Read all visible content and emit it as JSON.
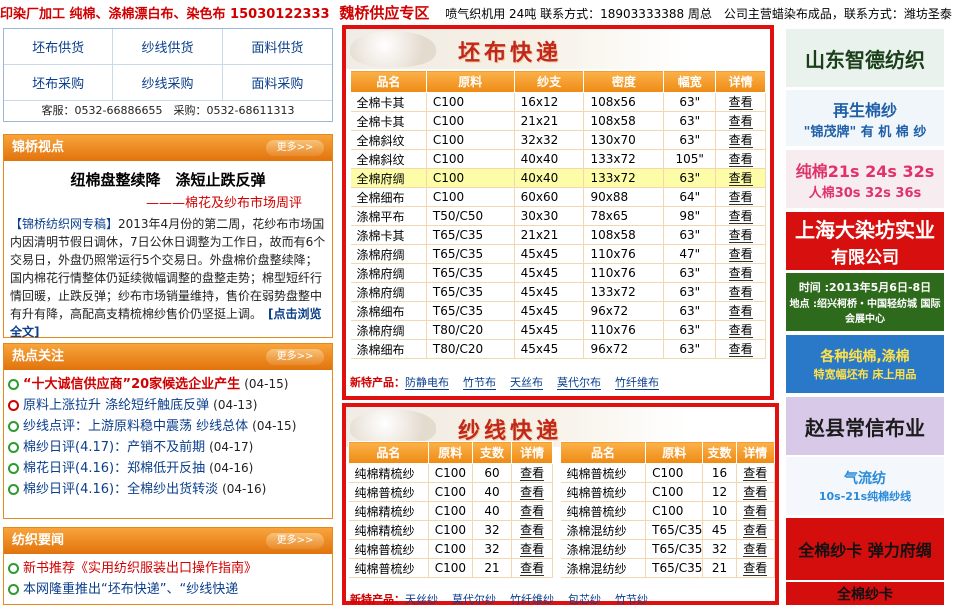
{
  "ticker": {
    "hot": "印染厂加工 纯棉、涤棉漂白布、染色布 15030122333",
    "zone": "魏桥供应专区",
    "rest": "喷气织机用 24吨 联系方式：18903333388 周总　公司主营蜡染布成品，联系方式：潍坊圣泰"
  },
  "nav": {
    "items": [
      "坯布供货",
      "纱线供货",
      "面料供货",
      "坯布采购",
      "纱线采购",
      "面料采购"
    ],
    "service": "客服：0532-66886655　采购：0532-68611313"
  },
  "panel1": {
    "title": "锦桥视点",
    "more": "更多>>",
    "headline": "纽棉盘整续降　涤短止跌反弹",
    "subline": "———棉花及纱布市场周评",
    "brand": "【锦桥纺织网专稿】",
    "body": "2013年4月份的第二周，花纱布市场国内因清明节假日调休，7日公休日调整为工作日，故而有6个交易日，外盘仍照常运行5个交易日。外盘棉价盘整续降；国内棉花行情整体仍延续微幅调整的盘整走势；棉型短纤行情回暖，止跌反弹；纱布市场销量维持，售价在弱势盘整中有升有降，高配高支精梳棉纱售价仍坚挺上调。",
    "read": "[点击浏览全文]"
  },
  "panel2": {
    "title": "热点关注",
    "more": "更多>>",
    "items": [
      {
        "t": "“十大诚信供应商”20家候选企业产生",
        "d": "(04-15)",
        "style": "hl"
      },
      {
        "t": "原料上涨拉升 涤纶短纤触底反弹",
        "d": "(04-13)",
        "style": "normal",
        "dot": "red"
      },
      {
        "t": "纱线点评：上游原料稳中震荡 纱线总体",
        "d": "(04-15)",
        "style": "normal"
      },
      {
        "t": "棉纱日评(4.17)：产销不及前期",
        "d": "(04-17)",
        "style": "normal"
      },
      {
        "t": "棉花日评(4.16)：郑棉低开反抽",
        "d": "(04-16)",
        "style": "normal"
      },
      {
        "t": "棉纱日评(4.16)：全棉纱出货转淡",
        "d": "(04-16)",
        "style": "normal"
      }
    ]
  },
  "panel3": {
    "title": "纺织要闻",
    "more": "更多>>",
    "items": [
      {
        "t": "新书推荐《实用纺织服装出口操作指南》",
        "style": "red"
      },
      {
        "t": "本网隆重推出“坯布快递”、“纱线快递",
        "style": "normal"
      }
    ]
  },
  "fabric": {
    "title": "坯布快递",
    "headers": [
      "品名",
      "原料",
      "纱支",
      "密度",
      "幅宽",
      "详情"
    ],
    "rows": [
      [
        "全棉卡其",
        "C100",
        "16x12",
        "108x56",
        "63\"",
        "查看"
      ],
      [
        "全棉卡其",
        "C100",
        "21x21",
        "108x58",
        "63\"",
        "查看"
      ],
      [
        "全棉斜纹",
        "C100",
        "32x32",
        "130x70",
        "63\"",
        "查看"
      ],
      [
        "全棉斜纹",
        "C100",
        "40x40",
        "133x72",
        "105\"",
        "查看"
      ],
      [
        "全棉府绸",
        "C100",
        "40x40",
        "133x72",
        "63\"",
        "查看"
      ],
      [
        "全棉细布",
        "C100",
        "60x60",
        "90x88",
        "64\"",
        "查看"
      ],
      [
        "涤棉平布",
        "T50/C50",
        "30x30",
        "78x65",
        "98\"",
        "查看"
      ],
      [
        "涤棉卡其",
        "T65/C35",
        "21x21",
        "108x58",
        "63\"",
        "查看"
      ],
      [
        "涤棉府绸",
        "T65/C35",
        "45x45",
        "110x76",
        "47\"",
        "查看"
      ],
      [
        "涤棉府绸",
        "T65/C35",
        "45x45",
        "110x76",
        "63\"",
        "查看"
      ],
      [
        "涤棉府绸",
        "T65/C35",
        "45x45",
        "133x72",
        "63\"",
        "查看"
      ],
      [
        "涤棉细布",
        "T65/C35",
        "45x45",
        "96x72",
        "63\"",
        "查看"
      ],
      [
        "涤棉府绸",
        "T80/C20",
        "45x45",
        "110x76",
        "63\"",
        "查看"
      ],
      [
        "涤棉细布",
        "T80/C20",
        "45x45",
        "96x72",
        "63\"",
        "查看"
      ]
    ],
    "highlight_row": 4,
    "special_label": "新特产品：",
    "special": [
      "防静电布",
      "竹节布",
      "天丝布",
      "莫代尔布",
      "竹纤维布"
    ]
  },
  "yarn": {
    "title": "纱线快递",
    "headers": [
      "品名",
      "原料",
      "支数",
      "详情"
    ],
    "left": [
      [
        "纯棉精梳纱",
        "C100",
        "60",
        "查看"
      ],
      [
        "纯棉普梳纱",
        "C100",
        "40",
        "查看"
      ],
      [
        "纯棉精梳纱",
        "C100",
        "40",
        "查看"
      ],
      [
        "纯棉精梳纱",
        "C100",
        "32",
        "查看"
      ],
      [
        "纯棉普梳纱",
        "C100",
        "32",
        "查看"
      ],
      [
        "纯棉普梳纱",
        "C100",
        "21",
        "查看"
      ]
    ],
    "right": [
      [
        "纯棉普梳纱",
        "C100",
        "16",
        "查看"
      ],
      [
        "纯棉普梳纱",
        "C100",
        "12",
        "查看"
      ],
      [
        "纯棉普梳纱",
        "C100",
        "10",
        "查看"
      ],
      [
        "涤棉混纺纱",
        "T65/C35",
        "45",
        "查看"
      ],
      [
        "涤棉混纺纱",
        "T65/C35",
        "32",
        "查看"
      ],
      [
        "涤棉混纺纱",
        "T65/C35",
        "21",
        "查看"
      ]
    ],
    "special_label": "新特产品：",
    "special": [
      "天丝纱",
      "莫代尔纱",
      "竹纤维纱",
      "包芯纱",
      "竹节纱"
    ]
  },
  "ads": [
    {
      "text": "山东智德纺织",
      "bg": "#e9f2ec",
      "color": "#1a3f1a"
    },
    {
      "text": "再生棉纱",
      "sub": "\"锦茂牌\" 有 机 棉 纱",
      "bg": "#f1f6fa",
      "color": "#1f5fa8"
    },
    {
      "text": "纯棉21s 24s 32s",
      "sub": "人棉30s 32s 36s",
      "bg": "#f7ecf0",
      "color": "#e0336b"
    },
    {
      "text": "上海大染坊实业",
      "sub": "有限公司",
      "bg": "#d80f0f",
      "color": "#ffffff"
    },
    {
      "text": "时间 :2013年5月6日-8日",
      "sub": "地点 :绍兴柯桥・中国轻纺城 国际会展中心",
      "bg": "#2e6a1c",
      "color": "#ffffff"
    },
    {
      "text": "各种纯棉,涤棉",
      "sub": "特宽幅坯布 床上用品",
      "bg": "#2a79c8",
      "color": "#ffe14a"
    },
    {
      "text": "赵县常信布业",
      "bg": "#d9c9e8",
      "color": "#1c1c1c"
    },
    {
      "text": "气流纺",
      "sub": "10s-21s纯棉纱线",
      "bg": "#f4f8fc",
      "color": "#2a8ad8"
    },
    {
      "text": "全棉纱卡 弹力府绸",
      "bg": "#d40d0d",
      "color": "#111111"
    },
    {
      "text": "全棉纱卡",
      "bg": "#d40d0d",
      "color": "#111111"
    }
  ]
}
